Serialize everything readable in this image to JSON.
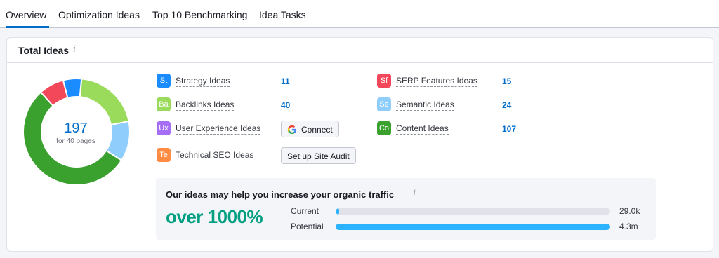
{
  "tabs": [
    {
      "label": "Overview",
      "active": true
    },
    {
      "label": "Optimization Ideas",
      "active": false
    },
    {
      "label": "Top 10 Benchmarking",
      "active": false
    },
    {
      "label": "Idea Tasks",
      "active": false
    }
  ],
  "card": {
    "title": "Total Ideas",
    "info_icon": "i"
  },
  "donut": {
    "total": "197",
    "subtitle": "for 40 pages"
  },
  "categories": [
    {
      "abbr": "St",
      "label": "Strategy Ideas",
      "count": "11",
      "color": "#1a8cff",
      "value": 11
    },
    {
      "abbr": "Ba",
      "label": "Backlinks Ideas",
      "count": "40",
      "color": "#9adb5c",
      "value": 40
    },
    {
      "abbr": "Ux",
      "label": "User Experience Ideas",
      "count": null,
      "action": "Connect",
      "color": "#a56ef5",
      "value": 0
    },
    {
      "abbr": "Te",
      "label": "Technical SEO Ideas",
      "count": null,
      "action": "Set up Site Audit",
      "color": "#ff8c42",
      "value": 0
    },
    {
      "abbr": "Sf",
      "label": "SERP Features Ideas",
      "count": "15",
      "color": "#f2485a",
      "value": 15
    },
    {
      "abbr": "Se",
      "label": "Semantic Ideas",
      "count": "24",
      "color": "#8fcdfc",
      "value": 24
    },
    {
      "abbr": "Co",
      "label": "Content Ideas",
      "count": "107",
      "color": "#3ba12e",
      "value": 107
    }
  ],
  "traffic": {
    "title": "Our ideas may help you increase your organic traffic",
    "info_icon": "i",
    "percent": "over 1000%",
    "current_label": "Current",
    "current_value": "29.0k",
    "current_fraction": 0.006,
    "potential_label": "Potential",
    "potential_value": "4.3m",
    "potential_fraction": 1.0,
    "bar_color": "#2bb3ff"
  },
  "icons": {
    "google": "google-icon",
    "info": "info-icon"
  }
}
